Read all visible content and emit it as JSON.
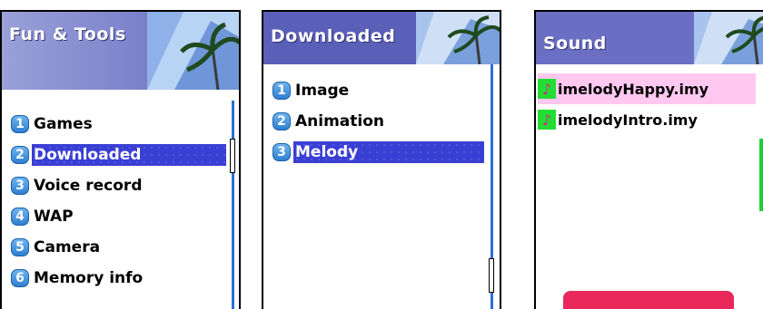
{
  "screens": [
    {
      "title": "Fun & Tools",
      "menu": [
        {
          "num": "1",
          "label": "Games"
        },
        {
          "num": "2",
          "label": "Downloaded",
          "selected": true
        },
        {
          "num": "3",
          "label": "Voice record"
        },
        {
          "num": "4",
          "label": "WAP"
        },
        {
          "num": "5",
          "label": "Camera"
        },
        {
          "num": "6",
          "label": "Memory info"
        }
      ]
    },
    {
      "title": "Downloaded",
      "menu": [
        {
          "num": "1",
          "label": "Image"
        },
        {
          "num": "2",
          "label": "Animation"
        },
        {
          "num": "3",
          "label": "Melody",
          "selected": true
        }
      ]
    },
    {
      "title": "Sound",
      "files": [
        {
          "icon": "music-note-icon",
          "name": "imelodyHappy.imy",
          "selected": true
        },
        {
          "icon": "music-note-icon",
          "name": "imelodyIntro.imy"
        }
      ]
    }
  ],
  "colors": {
    "selection": "#3a3fd4",
    "number_badge": "#2f7fd0",
    "file_highlight": "#ffc8f0",
    "file_icon_bg": "#22dd33"
  }
}
